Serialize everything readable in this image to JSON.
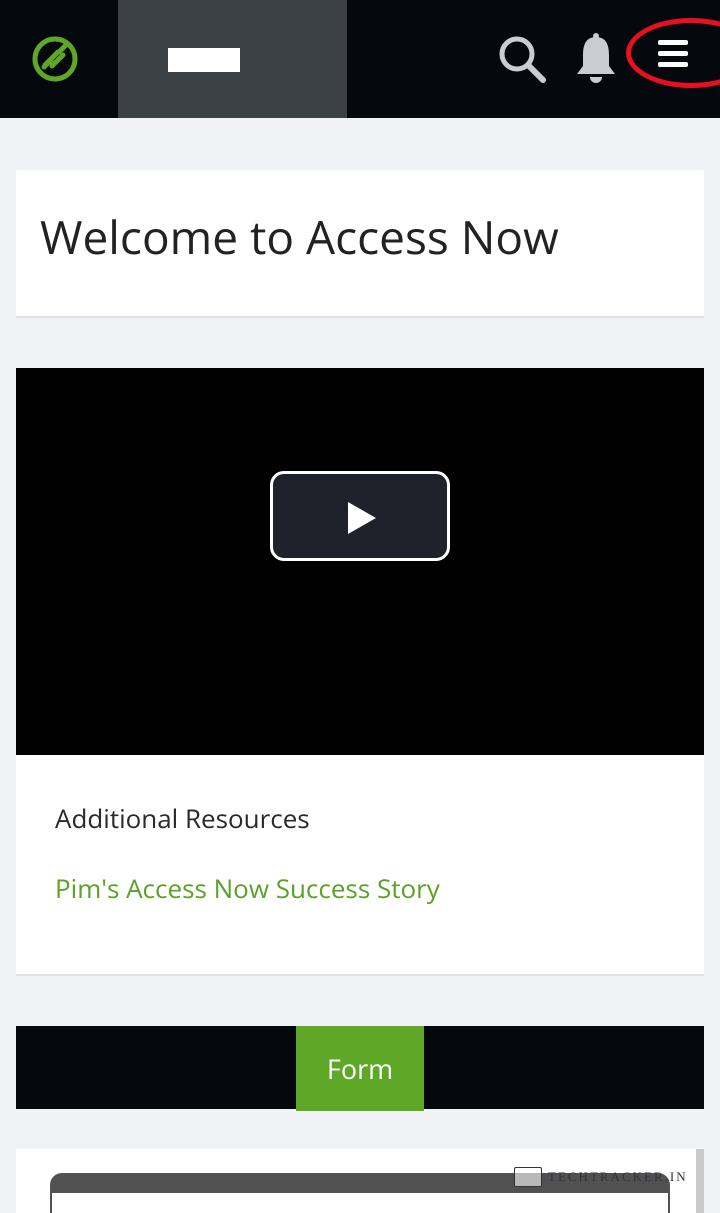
{
  "header": {
    "logo_icon": "access-now-logo-icon",
    "icons": [
      "search-icon",
      "bell-icon",
      "hamburger-menu-icon"
    ],
    "accent_color": "#5ea727",
    "highlight_color": "#e8101e"
  },
  "welcome": {
    "title": "Welcome to Access Now"
  },
  "video": {
    "play_icon": "play-icon"
  },
  "resources": {
    "heading": "Additional Resources",
    "link_label": "Pim's Access Now Success Story",
    "link_color": "#5aa125"
  },
  "form_tab": {
    "label": "Form"
  },
  "watermark": {
    "text": "TECHTRACKER.IN"
  }
}
